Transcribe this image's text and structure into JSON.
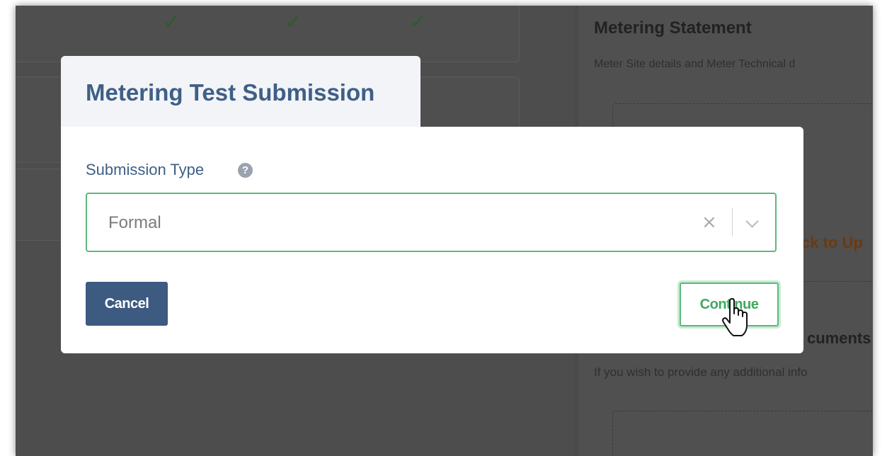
{
  "background": {
    "right_panel": {
      "title": "Metering Statement",
      "subtitle": "Meter Site details and Meter Technical d",
      "link_fragment": "ck to Up",
      "heading_fragment": "cuments",
      "text": "If you wish to provide any additional info"
    }
  },
  "modal": {
    "title": "Metering Test Submission",
    "field": {
      "label": "Submission Type",
      "help_icon": "question-circle-icon",
      "value": "Formal",
      "clear_icon": "×",
      "dropdown_icon": "chevron-down-icon"
    },
    "buttons": {
      "cancel": "Cancel",
      "continue": "Continue"
    }
  },
  "colors": {
    "accent_green": "#5cb87a",
    "primary_blue": "#3d5a80",
    "title_blue": "#3f5f86"
  }
}
